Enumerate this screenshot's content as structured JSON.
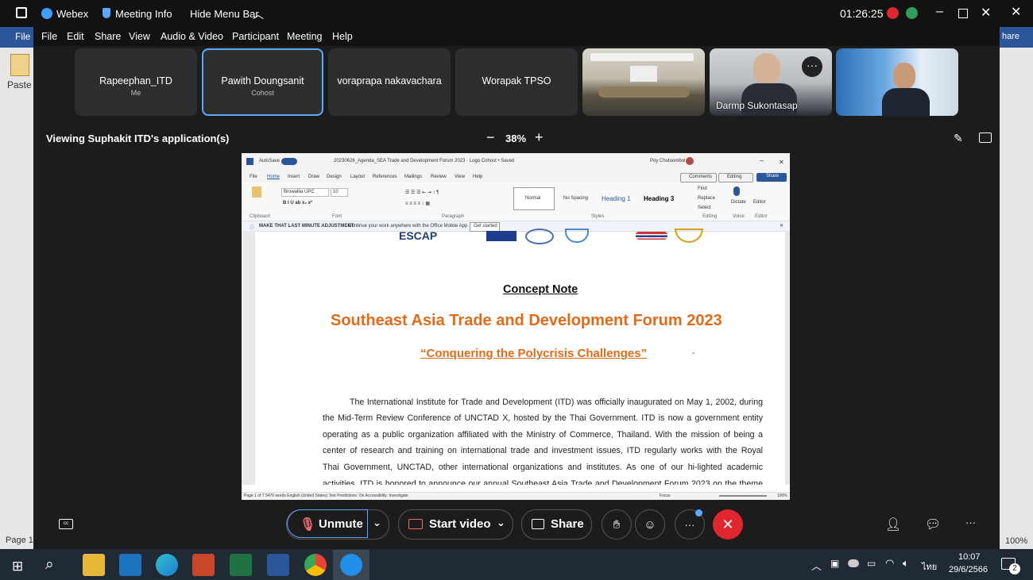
{
  "word_bg": {
    "file": "File",
    "paste": "Paste",
    "page": "Page 1",
    "zoom": "100%",
    "share": "hare"
  },
  "titlebar": {
    "app": "Webex",
    "meeting_info": "Meeting Info",
    "hide_menu": "Hide Menu Bar",
    "timer": "01:26:25"
  },
  "menu": [
    "File",
    "Edit",
    "Share",
    "View",
    "Audio & Video",
    "Participant",
    "Meeting",
    "Help"
  ],
  "participants": [
    {
      "name": "Rapeephan_ITD",
      "role": "Me"
    },
    {
      "name": "Pawith Doungsanit",
      "role": "Cohost"
    },
    {
      "name": "voraprapa nakavachara",
      "role": ""
    },
    {
      "name": "Worapak TPSO",
      "role": ""
    }
  ],
  "video_participants": [
    {
      "name": "Darmp Sukontasap"
    }
  ],
  "viewing": {
    "label": "Viewing Suphakit ITD's application(s)",
    "zoom": "38%",
    "minus": "−",
    "plus": "+"
  },
  "word": {
    "autosave": "AutoSave",
    "doc_title": "20230626_Agenda_SEA Trade and Development Forum 2023 · Logo Cohost • Saved",
    "user": "Poy Chutoombol",
    "tabs": [
      "File",
      "Home",
      "Insert",
      "Draw",
      "Design",
      "Layout",
      "References",
      "Mailings",
      "Review",
      "View",
      "Help"
    ],
    "comments": "Comments",
    "editing": "Editing",
    "share": "Share",
    "font": "Browallia UPC",
    "size": "10",
    "styles": [
      "Normal",
      "No Spacing",
      "Heading 1",
      "Heading 3"
    ],
    "groups": [
      "Clipboard",
      "Font",
      "Paragraph",
      "Styles",
      "Editing",
      "Voice",
      "Editor"
    ],
    "editing_items": [
      "Find",
      "Replace",
      "Select"
    ],
    "voice": "Dictate",
    "editor": "Editor",
    "notice_bold": "MAKE THAT LAST MINUTE ADJUSTMENT",
    "notice": "Continue your work anywhere with the Office Mobile App",
    "get_started": "Get started",
    "status_left": "Page 1 of 7     5476 words     English (United States)     Text Predictions: On     Accessibility: Investigate",
    "status_right": "Focus",
    "status_zoom": "100%"
  },
  "doc": {
    "heading": "Concept Note",
    "title": "Southeast Asia Trade and Development Forum 2023",
    "subtitle": "“Conquering the Polycrisis Challenges”",
    "lines": [
      "The International Institute for Trade and Development (ITD) was officially inaugurated on May 1, 2002, during",
      "the Mid-Term Review Conference of UNCTAD X, hosted by the Thai Government. ITD is now a government entity",
      "operating as a public organization affiliated with the Ministry of Commerce, Thailand. With the mission of being a",
      "center of research and training on international trade and investment issues, ITD regularly works with the Royal",
      "Thai Government, UNCTAD, other international organizations and institutes. As one of our hi-lighted academic",
      "activities, ITD is honored to announce our annual Southeast Asia Trade and Development Forum 2023 on the theme"
    ]
  },
  "controls": {
    "unmute": "Unmute",
    "start_video": "Start video",
    "share": "Share"
  },
  "taskbar": {
    "time": "10:07",
    "date": "29/6/2566",
    "lang": "ไทย",
    "notif": "2"
  },
  "colors": {
    "orange": "#e26b1a",
    "end_red": "#e0262f",
    "accent_blue": "#5aa9ff"
  }
}
